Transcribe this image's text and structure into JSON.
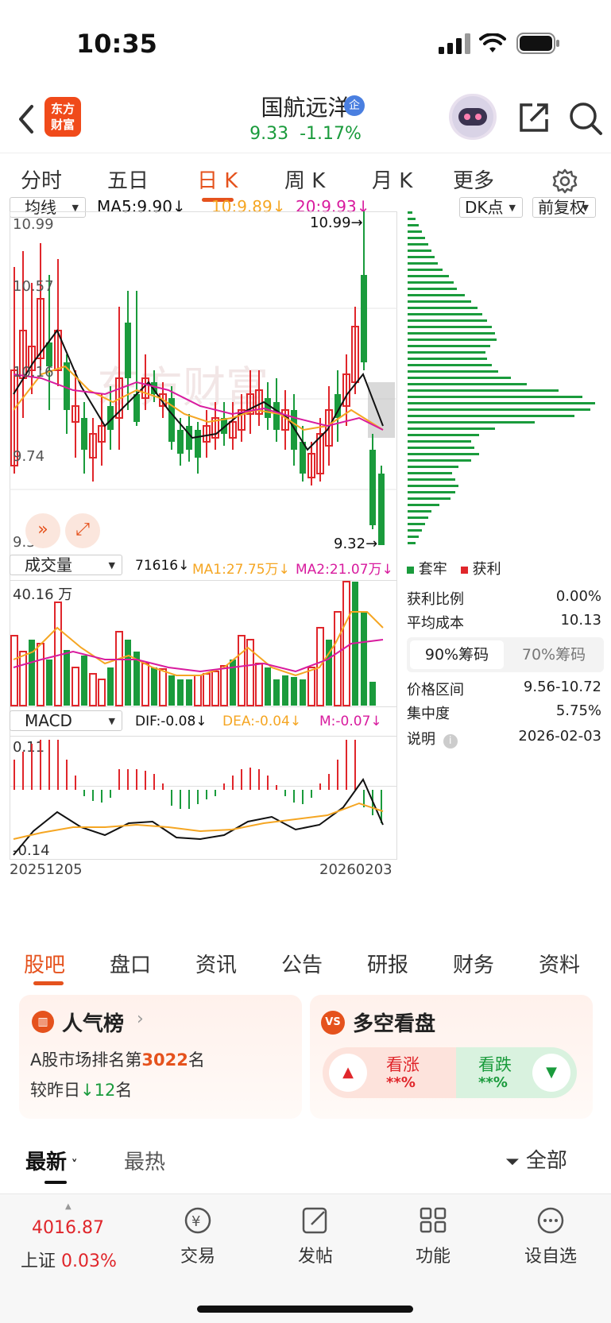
{
  "status": {
    "time": "10:35"
  },
  "header": {
    "logo_line1": "东方",
    "logo_line2": "财富",
    "stock_name": "国航远洋",
    "badge": "企",
    "price": "9.33",
    "change": "-1.17%"
  },
  "tabs": [
    "分时",
    "五日",
    "日 K",
    "周 K",
    "月 K",
    "更多"
  ],
  "kline": {
    "indicator": "均线",
    "ma5": "MA5:9.90↓",
    "ma10": "10:9.89↓",
    "ma20": "20:9.93↓",
    "dk_label": "DK点",
    "fq_label": "前复权",
    "axis_labels": [
      "10.99",
      "10.57",
      "10.16",
      "9.74",
      "9.32"
    ],
    "high_marker": "10.99→",
    "low_marker": "9.32→",
    "watermark": "东方财富"
  },
  "volume": {
    "indicator": "成交量",
    "value": "71616↓",
    "ma1": "MA1:27.75万↓",
    "ma2": "MA2:21.07万↓",
    "top_label": "40.16 万"
  },
  "macd": {
    "indicator": "MACD",
    "dif": "DIF:-0.08↓",
    "dea": "DEA:-0.04↓",
    "m": "M:-0.07↓",
    "top_label": "0.11",
    "bottom_label": "-0.14",
    "start_date": "20251205",
    "end_date": "20260203"
  },
  "chips": {
    "legend_locked": "套牢",
    "legend_profit": "获利",
    "profit_ratio_label": "获利比例",
    "profit_ratio": "0.00%",
    "avg_cost_label": "平均成本",
    "avg_cost": "10.13",
    "btn_90": "90%筹码",
    "btn_70": "70%筹码",
    "range_label": "价格区间",
    "range": "9.56-10.72",
    "concentration_label": "集中度",
    "concentration": "5.75%",
    "note_label": "说明",
    "note_date": "2026-02-03"
  },
  "bottom_tabs": [
    "股吧",
    "盘口",
    "资讯",
    "公告",
    "研报",
    "财务",
    "资料"
  ],
  "popularity": {
    "title": "人气榜",
    "rank_prefix": "A股市场排名第",
    "rank": "3022",
    "rank_suffix": "名",
    "change_prefix": "较昨日",
    "change": "12",
    "change_suffix": "名"
  },
  "bull_bear": {
    "title": "多空看盘",
    "bull_label": "看涨",
    "bull_value": "**%",
    "bear_label": "看跌",
    "bear_value": "**%"
  },
  "sort": {
    "latest": "最新",
    "hot": "最热",
    "filter": "全部"
  },
  "bottom_bar": {
    "index_value": "4016.87",
    "index_name": "上证",
    "index_change": "0.03%",
    "items": [
      "交易",
      "发帖",
      "功能",
      "设自选"
    ]
  },
  "colors": {
    "up": "#e0262b",
    "down": "#1a9b3c",
    "accent": "#e5521d",
    "ma5": "#111111",
    "ma10": "#f5a623",
    "ma20": "#d81b9e"
  }
}
